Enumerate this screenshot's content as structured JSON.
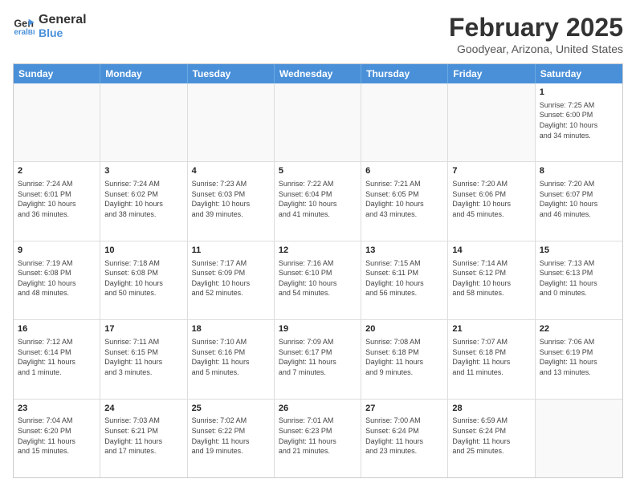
{
  "header": {
    "logo_line1": "General",
    "logo_line2": "Blue",
    "month_title": "February 2025",
    "location": "Goodyear, Arizona, United States"
  },
  "weekdays": [
    "Sunday",
    "Monday",
    "Tuesday",
    "Wednesday",
    "Thursday",
    "Friday",
    "Saturday"
  ],
  "weeks": [
    [
      {
        "day": "",
        "info": ""
      },
      {
        "day": "",
        "info": ""
      },
      {
        "day": "",
        "info": ""
      },
      {
        "day": "",
        "info": ""
      },
      {
        "day": "",
        "info": ""
      },
      {
        "day": "",
        "info": ""
      },
      {
        "day": "1",
        "info": "Sunrise: 7:25 AM\nSunset: 6:00 PM\nDaylight: 10 hours\nand 34 minutes."
      }
    ],
    [
      {
        "day": "2",
        "info": "Sunrise: 7:24 AM\nSunset: 6:01 PM\nDaylight: 10 hours\nand 36 minutes."
      },
      {
        "day": "3",
        "info": "Sunrise: 7:24 AM\nSunset: 6:02 PM\nDaylight: 10 hours\nand 38 minutes."
      },
      {
        "day": "4",
        "info": "Sunrise: 7:23 AM\nSunset: 6:03 PM\nDaylight: 10 hours\nand 39 minutes."
      },
      {
        "day": "5",
        "info": "Sunrise: 7:22 AM\nSunset: 6:04 PM\nDaylight: 10 hours\nand 41 minutes."
      },
      {
        "day": "6",
        "info": "Sunrise: 7:21 AM\nSunset: 6:05 PM\nDaylight: 10 hours\nand 43 minutes."
      },
      {
        "day": "7",
        "info": "Sunrise: 7:20 AM\nSunset: 6:06 PM\nDaylight: 10 hours\nand 45 minutes."
      },
      {
        "day": "8",
        "info": "Sunrise: 7:20 AM\nSunset: 6:07 PM\nDaylight: 10 hours\nand 46 minutes."
      }
    ],
    [
      {
        "day": "9",
        "info": "Sunrise: 7:19 AM\nSunset: 6:08 PM\nDaylight: 10 hours\nand 48 minutes."
      },
      {
        "day": "10",
        "info": "Sunrise: 7:18 AM\nSunset: 6:08 PM\nDaylight: 10 hours\nand 50 minutes."
      },
      {
        "day": "11",
        "info": "Sunrise: 7:17 AM\nSunset: 6:09 PM\nDaylight: 10 hours\nand 52 minutes."
      },
      {
        "day": "12",
        "info": "Sunrise: 7:16 AM\nSunset: 6:10 PM\nDaylight: 10 hours\nand 54 minutes."
      },
      {
        "day": "13",
        "info": "Sunrise: 7:15 AM\nSunset: 6:11 PM\nDaylight: 10 hours\nand 56 minutes."
      },
      {
        "day": "14",
        "info": "Sunrise: 7:14 AM\nSunset: 6:12 PM\nDaylight: 10 hours\nand 58 minutes."
      },
      {
        "day": "15",
        "info": "Sunrise: 7:13 AM\nSunset: 6:13 PM\nDaylight: 11 hours\nand 0 minutes."
      }
    ],
    [
      {
        "day": "16",
        "info": "Sunrise: 7:12 AM\nSunset: 6:14 PM\nDaylight: 11 hours\nand 1 minute."
      },
      {
        "day": "17",
        "info": "Sunrise: 7:11 AM\nSunset: 6:15 PM\nDaylight: 11 hours\nand 3 minutes."
      },
      {
        "day": "18",
        "info": "Sunrise: 7:10 AM\nSunset: 6:16 PM\nDaylight: 11 hours\nand 5 minutes."
      },
      {
        "day": "19",
        "info": "Sunrise: 7:09 AM\nSunset: 6:17 PM\nDaylight: 11 hours\nand 7 minutes."
      },
      {
        "day": "20",
        "info": "Sunrise: 7:08 AM\nSunset: 6:18 PM\nDaylight: 11 hours\nand 9 minutes."
      },
      {
        "day": "21",
        "info": "Sunrise: 7:07 AM\nSunset: 6:18 PM\nDaylight: 11 hours\nand 11 minutes."
      },
      {
        "day": "22",
        "info": "Sunrise: 7:06 AM\nSunset: 6:19 PM\nDaylight: 11 hours\nand 13 minutes."
      }
    ],
    [
      {
        "day": "23",
        "info": "Sunrise: 7:04 AM\nSunset: 6:20 PM\nDaylight: 11 hours\nand 15 minutes."
      },
      {
        "day": "24",
        "info": "Sunrise: 7:03 AM\nSunset: 6:21 PM\nDaylight: 11 hours\nand 17 minutes."
      },
      {
        "day": "25",
        "info": "Sunrise: 7:02 AM\nSunset: 6:22 PM\nDaylight: 11 hours\nand 19 minutes."
      },
      {
        "day": "26",
        "info": "Sunrise: 7:01 AM\nSunset: 6:23 PM\nDaylight: 11 hours\nand 21 minutes."
      },
      {
        "day": "27",
        "info": "Sunrise: 7:00 AM\nSunset: 6:24 PM\nDaylight: 11 hours\nand 23 minutes."
      },
      {
        "day": "28",
        "info": "Sunrise: 6:59 AM\nSunset: 6:24 PM\nDaylight: 11 hours\nand 25 minutes."
      },
      {
        "day": "",
        "info": ""
      }
    ]
  ]
}
